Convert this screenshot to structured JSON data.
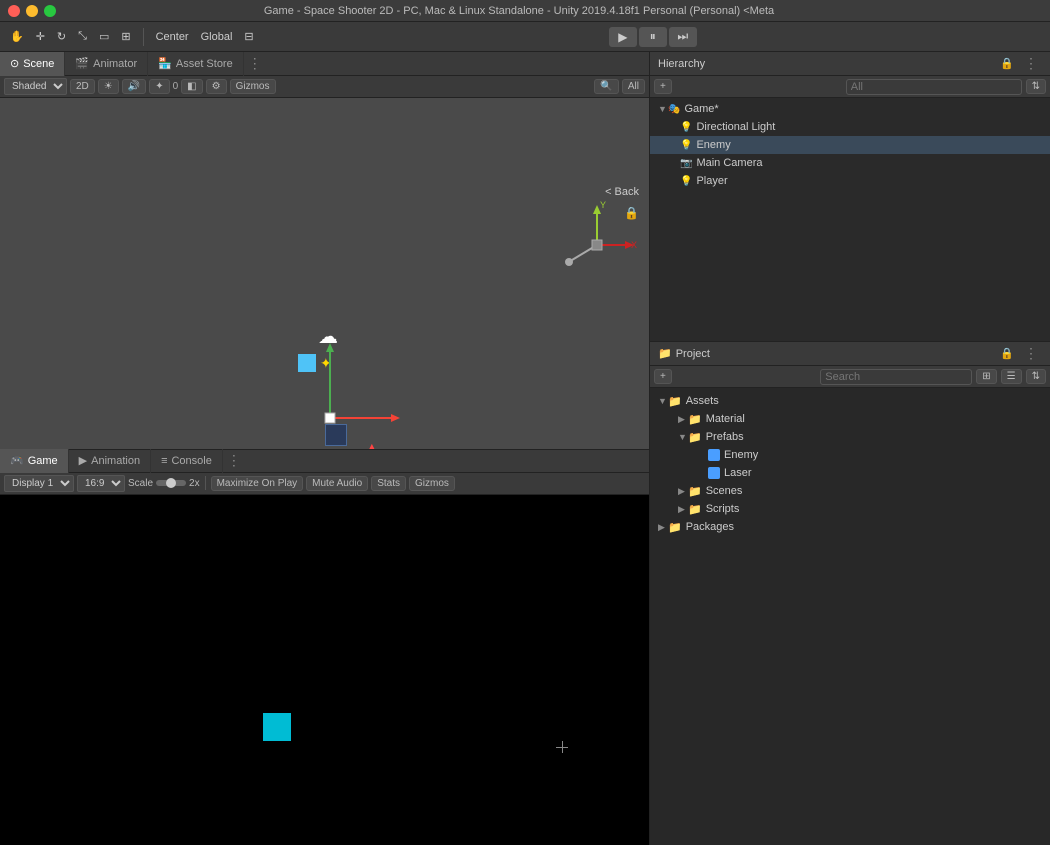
{
  "titleBar": {
    "title": "Game - Space Shooter 2D - PC, Mac & Linux Standalone - Unity 2019.4.18f1 Personal (Personal) <Meta"
  },
  "toolbar": {
    "tools": [
      "hand",
      "move",
      "rotate",
      "scale",
      "rect",
      "transform"
    ],
    "center_label": "Center",
    "global_label": "Global",
    "grid_label": "Grid",
    "play": "▶",
    "pause": "⏸",
    "step": "⏭"
  },
  "sceneTabs": {
    "scene_label": "Scene",
    "animator_label": "Animator",
    "assetstore_label": "Asset Store"
  },
  "sceneToolbar": {
    "shading": "Shaded",
    "mode": "2D",
    "gizmos_label": "Gizmos",
    "all_label": "All"
  },
  "gameTabs": {
    "game_label": "Game",
    "animation_label": "Animation",
    "console_label": "Console"
  },
  "gameToolbar": {
    "display": "Display 1",
    "resolution": "16:9",
    "scale_label": "Scale",
    "scale_value": "2x",
    "maximize_label": "Maximize On Play",
    "mute_label": "Mute Audio",
    "stats_label": "Stats",
    "gizmos_label": "Gizmos"
  },
  "hierarchy": {
    "title": "Hierarchy",
    "search_placeholder": "All",
    "items": [
      {
        "name": "Game*",
        "level": 1,
        "expanded": true
      },
      {
        "name": "Directional Light",
        "level": 2
      },
      {
        "name": "Enemy",
        "level": 2,
        "highlighted": true
      },
      {
        "name": "Main Camera",
        "level": 2
      },
      {
        "name": "Player",
        "level": 2
      }
    ]
  },
  "project": {
    "title": "Project",
    "search_placeholder": "Search",
    "items": [
      {
        "name": "Assets",
        "level": 1,
        "type": "folder",
        "expanded": true
      },
      {
        "name": "Material",
        "level": 2,
        "type": "folder"
      },
      {
        "name": "Prefabs",
        "level": 2,
        "type": "folder",
        "expanded": true
      },
      {
        "name": "Enemy",
        "level": 3,
        "type": "asset"
      },
      {
        "name": "Laser",
        "level": 3,
        "type": "asset"
      },
      {
        "name": "Scenes",
        "level": 2,
        "type": "folder"
      },
      {
        "name": "Scripts",
        "level": 2,
        "type": "folder"
      },
      {
        "name": "Packages",
        "level": 1,
        "type": "folder"
      }
    ]
  },
  "sceneView": {
    "back_label": "< Back"
  },
  "gameView": {
    "cursor_visible": true
  }
}
